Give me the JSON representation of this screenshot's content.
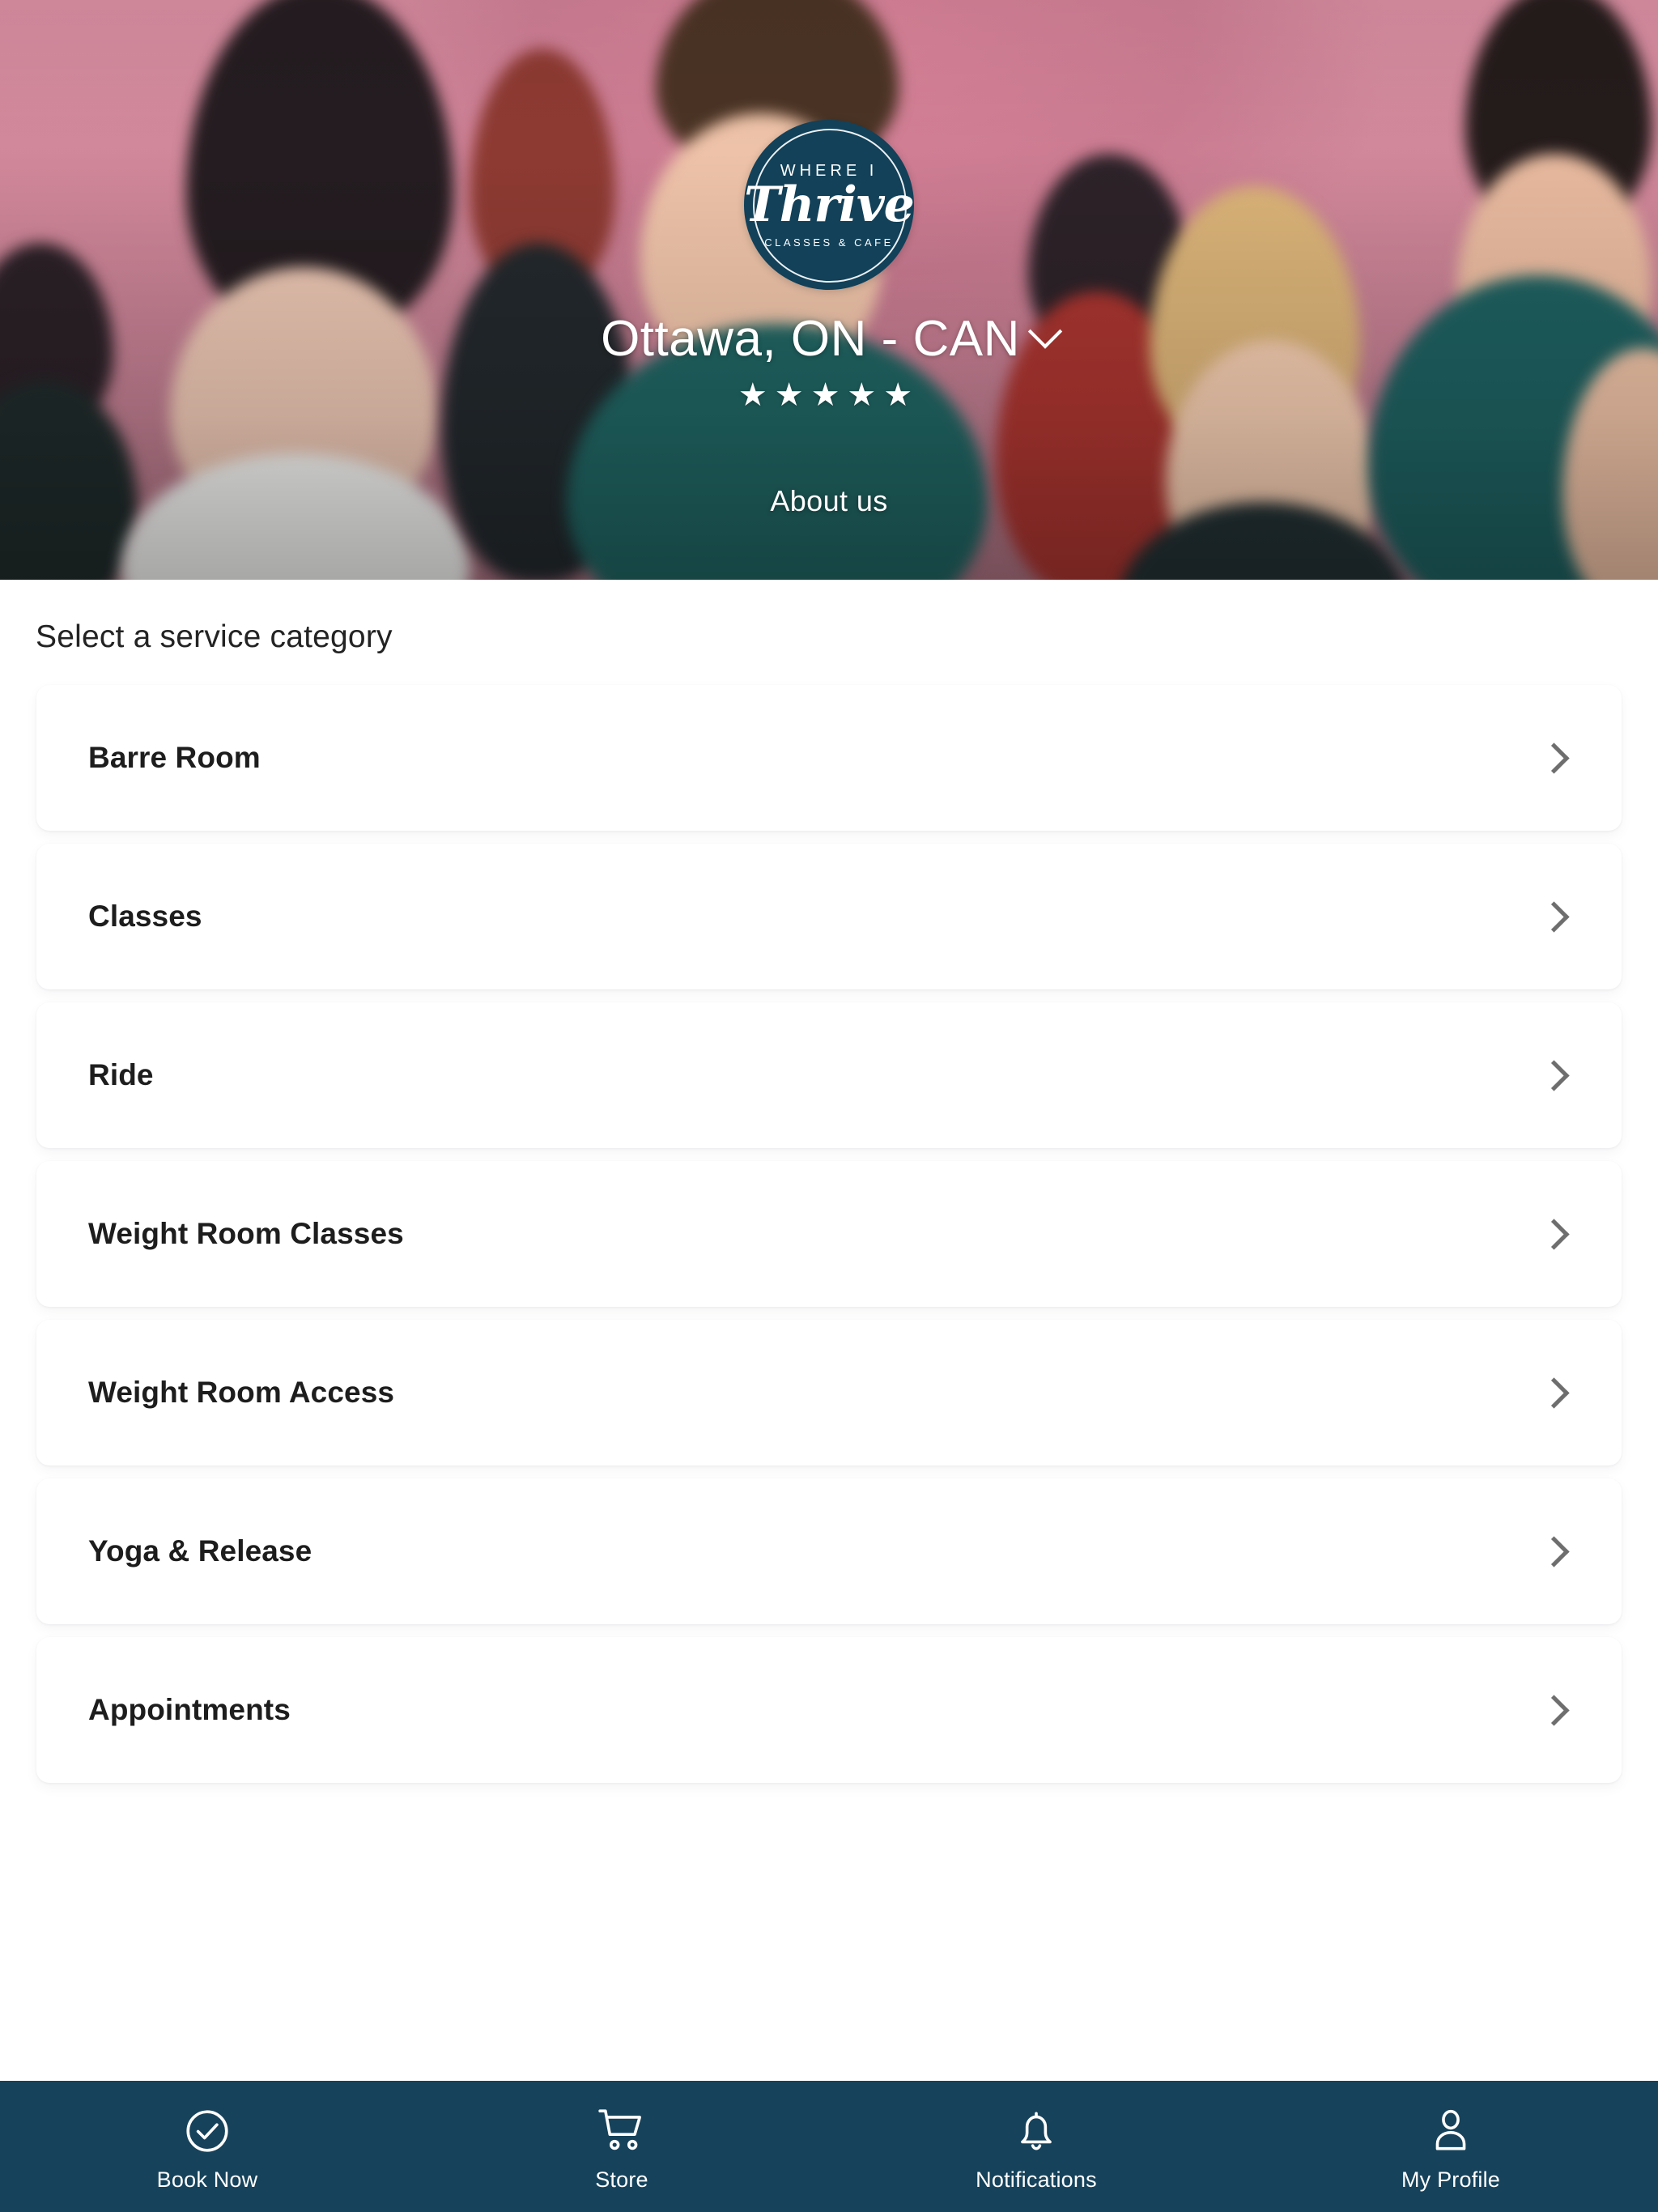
{
  "hero": {
    "logo": {
      "top_text": "WHERE I",
      "script_text": "Thrive",
      "bottom_text": "CLASSES & CAFE",
      "badge_color": "#124159"
    },
    "location_title": "Ottawa, ON - CAN",
    "location_chevron_icon": "chevron-down-icon",
    "rating_stars": "★★★★★",
    "rating_value": 5,
    "rating_max": 5,
    "about_link": "About us"
  },
  "main": {
    "section_title": "Select a service category",
    "categories": [
      {
        "label": "Barre Room",
        "chevron_icon": "chevron-right-icon"
      },
      {
        "label": "Classes",
        "chevron_icon": "chevron-right-icon"
      },
      {
        "label": "Ride",
        "chevron_icon": "chevron-right-icon"
      },
      {
        "label": "Weight Room Classes",
        "chevron_icon": "chevron-right-icon"
      },
      {
        "label": "Weight Room Access",
        "chevron_icon": "chevron-right-icon"
      },
      {
        "label": "Yoga & Release",
        "chevron_icon": "chevron-right-icon"
      },
      {
        "label": "Appointments",
        "chevron_icon": "chevron-right-icon"
      }
    ]
  },
  "bottom_nav": {
    "background_color": "#16425b",
    "items": [
      {
        "label": "Book Now",
        "icon": "check-circle-icon"
      },
      {
        "label": "Store",
        "icon": "shopping-cart-icon"
      },
      {
        "label": "Notifications",
        "icon": "bell-icon"
      },
      {
        "label": "My Profile",
        "icon": "person-icon"
      }
    ]
  }
}
